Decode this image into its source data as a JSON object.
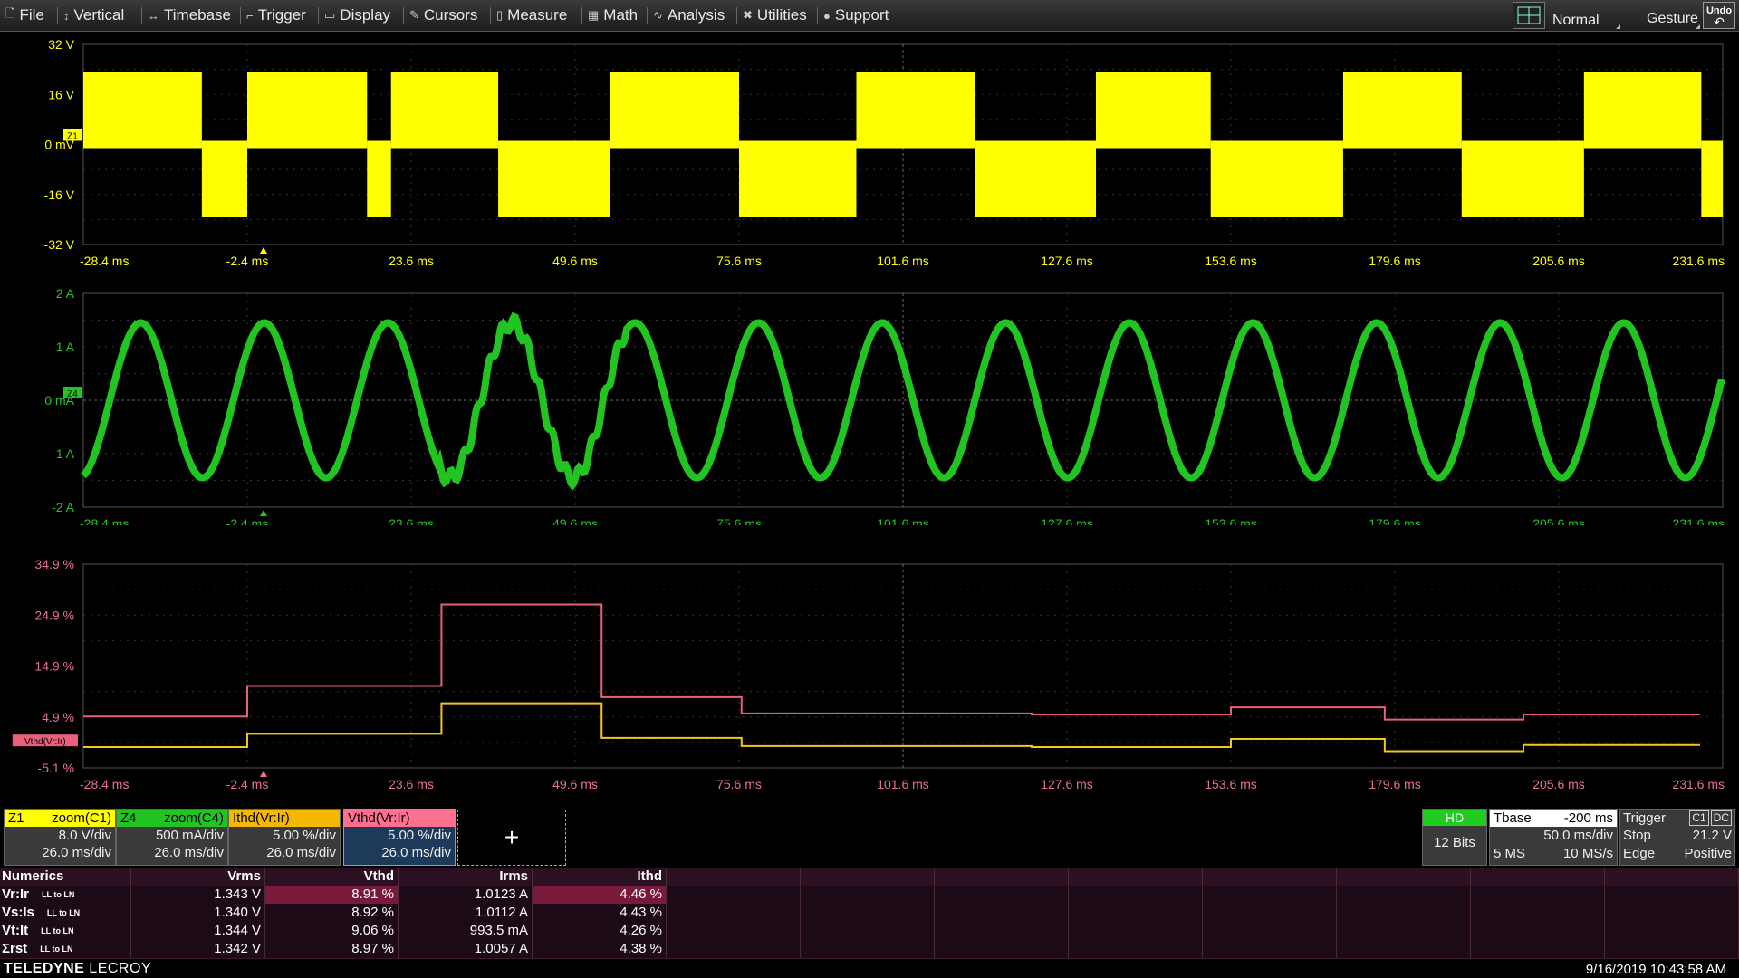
{
  "menu": {
    "items": [
      {
        "icon": "file-icon",
        "glyph": "🗋",
        "label": "File",
        "x": 6
      },
      {
        "icon": "vertical-icon",
        "glyph": "↕",
        "label": "Vertical",
        "x": 70
      },
      {
        "icon": "timebase-icon",
        "glyph": "↔",
        "label": "Timebase",
        "x": 163
      },
      {
        "icon": "trigger-icon",
        "glyph": "⌐",
        "label": "Trigger",
        "x": 272
      },
      {
        "icon": "display-icon",
        "glyph": "▭",
        "label": "Display",
        "x": 358
      },
      {
        "icon": "cursors-icon",
        "glyph": "✎",
        "label": "Cursors",
        "x": 452
      },
      {
        "icon": "measure-icon",
        "glyph": "▯",
        "label": "Measure",
        "x": 548
      },
      {
        "icon": "math-icon",
        "glyph": "▦",
        "label": "Math",
        "x": 649
      },
      {
        "icon": "analysis-icon",
        "glyph": "∿",
        "label": "Analysis",
        "x": 721
      },
      {
        "icon": "utilities-icon",
        "glyph": "✖",
        "label": "Utilities",
        "x": 820
      },
      {
        "icon": "support-icon",
        "glyph": "●",
        "label": "Support",
        "x": 909
      }
    ],
    "mode": "Normal",
    "gesture": "Gesture",
    "undo": "Undo"
  },
  "time_ticks": [
    "-28.4 ms",
    "-2.4 ms",
    "23.6 ms",
    "49.6 ms",
    "75.6 ms",
    "101.6 ms",
    "127.6 ms",
    "153.6 ms",
    "179.6 ms",
    "205.6 ms",
    "231.6 ms"
  ],
  "plots": {
    "z1": {
      "color": "#ffff00",
      "marker": "Z1",
      "y_labels": [
        "32 V",
        "16 V",
        "0 mV",
        "-16 V",
        "-32 V"
      ]
    },
    "z4": {
      "color": "#22c422",
      "marker": "Z4",
      "y_labels": [
        "2 A",
        "1 A",
        "0 mA",
        "-1 A",
        "-2 A"
      ]
    },
    "thd": {
      "color": "#e8607a",
      "marker": "Vthd(Vr:Ir)",
      "y_labels": [
        "34.9 %",
        "24.9 %",
        "14.9 %",
        "4.9 %",
        "-5.1 %"
      ]
    }
  },
  "chart_data": {
    "type": "line",
    "x_ticks": [
      "-28.4 ms",
      "-2.4 ms",
      "23.6 ms",
      "49.6 ms",
      "75.6 ms",
      "101.6 ms",
      "127.6 ms",
      "153.6 ms",
      "179.6 ms",
      "205.6 ms",
      "231.6 ms"
    ],
    "xlim_ms": [
      -28.4,
      231.6
    ],
    "series": [
      {
        "name": "Vthd(Vr:Ir)",
        "color": "#e8607a",
        "steps": [
          [
            -28.4,
            5.0
          ],
          [
            -2.4,
            11.0
          ],
          [
            28.4,
            27.0
          ],
          [
            53.8,
            8.8
          ],
          [
            76.0,
            5.6
          ],
          [
            122.0,
            5.4
          ],
          [
            153.6,
            6.8
          ],
          [
            178.0,
            4.4
          ],
          [
            200.0,
            5.4
          ],
          [
            228.0,
            5.4
          ]
        ]
      },
      {
        "name": "Ithd(Vr:Ir)",
        "color": "#f5c518",
        "steps": [
          [
            -28.4,
            -1.0
          ],
          [
            -2.4,
            1.6
          ],
          [
            28.4,
            7.6
          ],
          [
            53.8,
            0.8
          ],
          [
            76.0,
            -0.8
          ],
          [
            122.0,
            -1.0
          ],
          [
            153.6,
            0.6
          ],
          [
            178.0,
            -1.8
          ],
          [
            200.0,
            -0.6
          ],
          [
            228.0,
            -0.6
          ]
        ]
      }
    ],
    "ylim": [
      -5.1,
      34.9
    ],
    "grid": true
  },
  "channels": [
    {
      "id": "Z1",
      "src": "zoom(C1)",
      "vdiv": "8.0 V/div",
      "tdiv": "26.0 ms/div",
      "color": "#ffff00"
    },
    {
      "id": "Z4",
      "src": "zoom(C4)",
      "vdiv": "500 mA/div",
      "tdiv": "26.0 ms/div",
      "color": "#22c422"
    },
    {
      "id": "",
      "src": "Ithd(Vr:Ir)",
      "vdiv": "5.00 %/div",
      "tdiv": "26.0 ms/div",
      "color": "#f5b800"
    },
    {
      "id": "",
      "src": "Vthd(Vr:Ir)",
      "vdiv": "5.00 %/div",
      "tdiv": "26.0 ms/div",
      "color": "#ff7090"
    }
  ],
  "add_label": "+",
  "acq": {
    "hd": "HD",
    "bits": "12 Bits"
  },
  "tbase": {
    "label": "Tbase",
    "offset": "-200 ms",
    "tdiv": "50.0 ms/div",
    "samples": "5 MS",
    "rate": "10 MS/s"
  },
  "trigger": {
    "label": "Trigger",
    "ch": "C1",
    "coupling": "DC",
    "mode": "Stop",
    "level": "21.2 V",
    "type": "Edge",
    "slope": "Positive"
  },
  "numerics": {
    "title": "Numerics",
    "headers": [
      "Vrms",
      "Vthd",
      "Irms",
      "Ithd"
    ],
    "rows": [
      {
        "name": "Vr:Ir",
        "sub": "LL to LN",
        "vals": [
          "1.343 V",
          "8.91 %",
          "1.0123 A",
          "4.46 %"
        ]
      },
      {
        "name": "Vs:Is",
        "sub": "LL to LN",
        "vals": [
          "1.340 V",
          "8.92 %",
          "1.0112 A",
          "4.43 %"
        ]
      },
      {
        "name": "Vt:It",
        "sub": "LL to LN",
        "vals": [
          "1.344 V",
          "9.06 %",
          "993.5 mA",
          "4.26 %"
        ]
      },
      {
        "name": "Σrst",
        "sub": "LL to LN",
        "vals": [
          "1.342 V",
          "8.97 %",
          "1.0057 A",
          "4.38 %"
        ]
      }
    ]
  },
  "footer": {
    "brand1": "TELEDYNE",
    "brand2": " LECROY",
    "datetime": "9/16/2019 10:43:58 AM"
  }
}
